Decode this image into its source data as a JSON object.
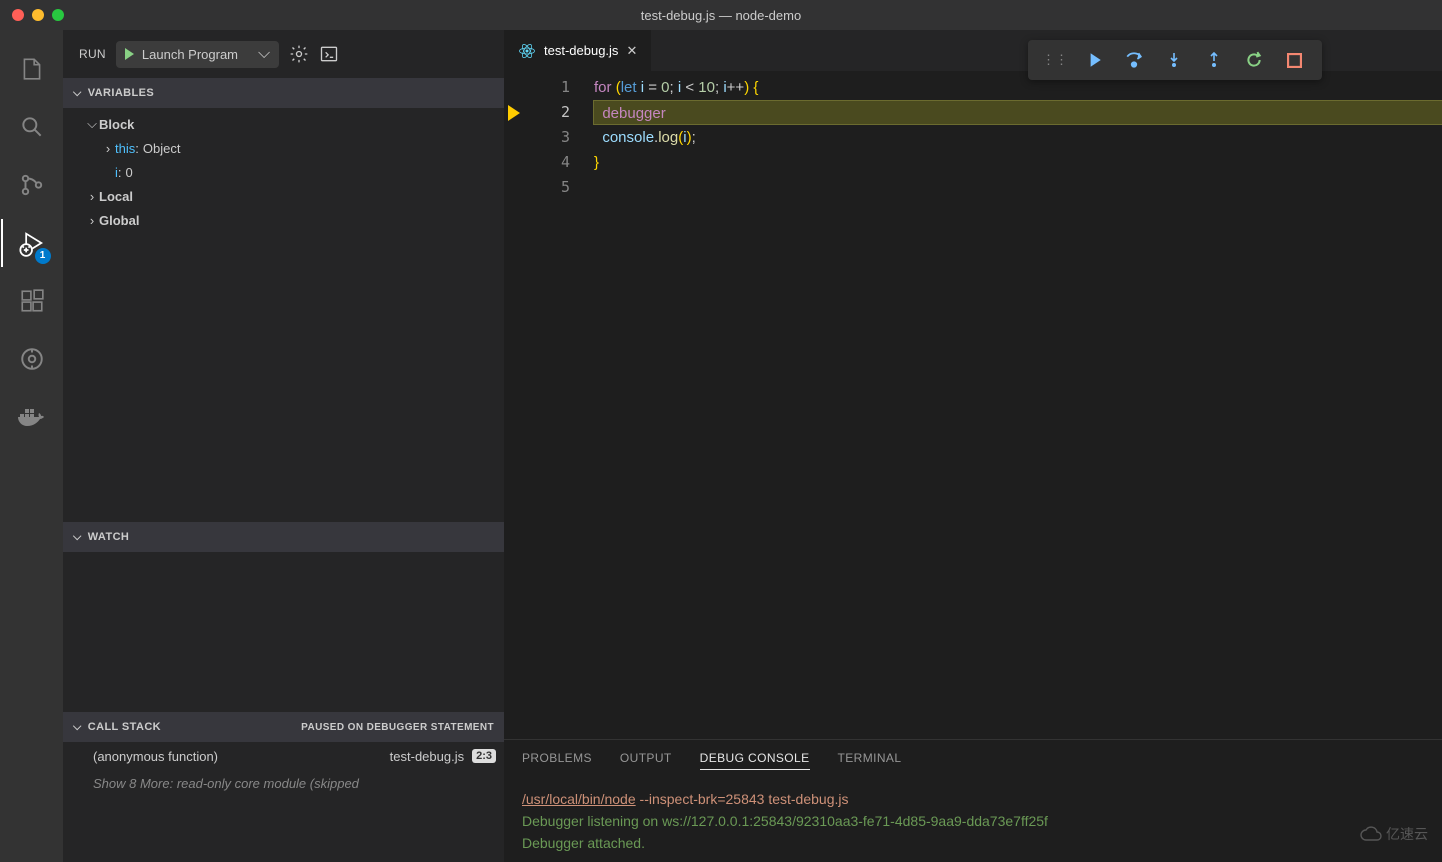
{
  "window": {
    "title": "test-debug.js — node-demo"
  },
  "run": {
    "label": "RUN",
    "config": "Launch Program"
  },
  "variables": {
    "header": "VARIABLES",
    "scopes": [
      {
        "name": "Block",
        "expanded": true,
        "vars": [
          {
            "name": "this",
            "value": "Object",
            "expandable": true
          },
          {
            "name": "i",
            "value": "0",
            "expandable": false
          }
        ]
      },
      {
        "name": "Local",
        "expanded": false,
        "vars": []
      },
      {
        "name": "Global",
        "expanded": false,
        "vars": []
      }
    ]
  },
  "watch": {
    "header": "WATCH"
  },
  "callstack": {
    "header": "CALL STACK",
    "status": "PAUSED ON DEBUGGER STATEMENT",
    "frames": [
      {
        "fn": "(anonymous function)",
        "file": "test-debug.js",
        "loc": "2:3"
      }
    ],
    "more": "Show 8 More: read-only core module (skipped"
  },
  "tab": {
    "title": "test-debug.js"
  },
  "editor": {
    "lines": [
      {
        "n": 1,
        "tokens": [
          [
            "kw",
            "for"
          ],
          [
            "pn",
            " "
          ],
          [
            "br",
            "("
          ],
          [
            "kw2",
            "let"
          ],
          [
            "pn",
            " "
          ],
          [
            "id",
            "i"
          ],
          [
            "pn",
            " = "
          ],
          [
            "num",
            "0"
          ],
          [
            "pn",
            "; "
          ],
          [
            "id",
            "i"
          ],
          [
            "pn",
            " < "
          ],
          [
            "num",
            "10"
          ],
          [
            "pn",
            "; "
          ],
          [
            "id",
            "i"
          ],
          [
            "pn",
            "++"
          ],
          [
            "br",
            ")"
          ],
          [
            "pn",
            " "
          ],
          [
            "br",
            "{"
          ]
        ]
      },
      {
        "n": 2,
        "hl": true,
        "bp": true,
        "tokens": [
          [
            "pn",
            "  "
          ],
          [
            "kw",
            "debugger"
          ]
        ]
      },
      {
        "n": 3,
        "tokens": [
          [
            "pn",
            "  "
          ],
          [
            "id",
            "console"
          ],
          [
            "pn",
            "."
          ],
          [
            "fn",
            "log"
          ],
          [
            "br",
            "("
          ],
          [
            "id",
            "i"
          ],
          [
            "br",
            ")"
          ],
          [
            "pn",
            ";"
          ]
        ]
      },
      {
        "n": 4,
        "tokens": [
          [
            "br",
            "}"
          ]
        ]
      },
      {
        "n": 5,
        "tokens": []
      }
    ]
  },
  "panel": {
    "tabs": [
      "PROBLEMS",
      "OUTPUT",
      "DEBUG CONSOLE",
      "TERMINAL"
    ],
    "active": 2,
    "console": {
      "cmd_path": "/usr/local/bin/node",
      "cmd_args": " --inspect-brk=25843 test-debug.js",
      "listen": "Debugger listening on ws://127.0.0.1:25843/92310aa3-fe71-4d85-9aa9-dda73e7ff25f",
      "attached": "Debugger attached."
    }
  },
  "debug_badge": "1",
  "watermark": "亿速云"
}
